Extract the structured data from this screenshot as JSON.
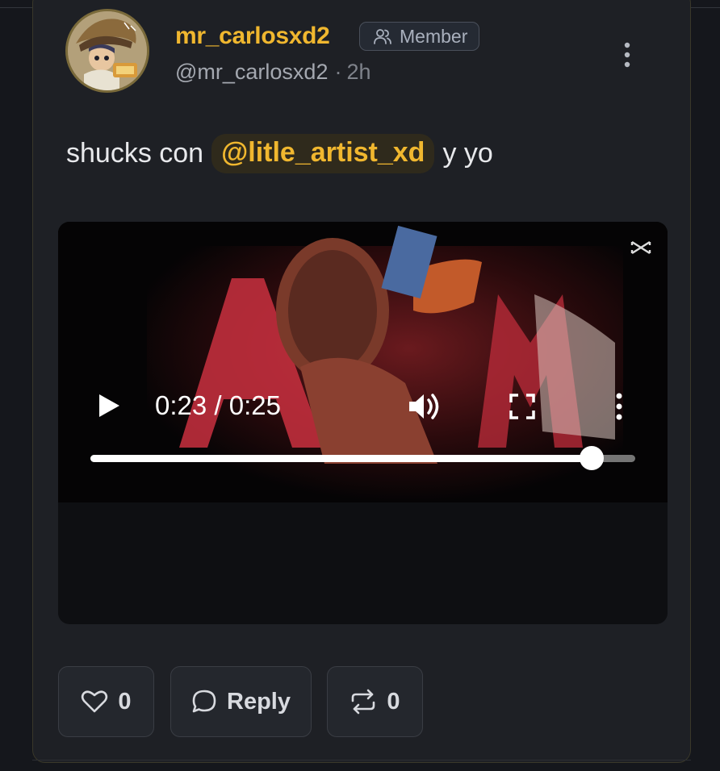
{
  "post": {
    "author": {
      "display_name": "mr_carlosxd2",
      "badge_label": "Member",
      "handle": "@mr_carlosxd2",
      "separator": "·",
      "time_ago": "2h"
    },
    "text_before": "shucks con",
    "mention": "@litle_artist_xd",
    "text_after": "y yo"
  },
  "video": {
    "current_time": "0:23",
    "duration": "0:25",
    "time_readout": "0:23 / 0:25",
    "progress_fraction": 0.92
  },
  "actions": {
    "like_count": "0",
    "reply_label": "Reply",
    "repost_count": "0"
  },
  "colors": {
    "accent": "#f0b72f",
    "card_bg": "#1e2025",
    "page_bg": "#15171c",
    "badge_text": "#a9b0bd"
  },
  "icons": {
    "badge": "users-icon",
    "more": "more-vertical-icon",
    "play": "play-icon",
    "volume": "volume-icon",
    "fullscreen": "fullscreen-icon",
    "video_more": "more-vertical-icon",
    "like": "heart-icon",
    "reply": "comment-icon",
    "repost": "repost-icon",
    "watermark": "capcut-logo-icon"
  }
}
